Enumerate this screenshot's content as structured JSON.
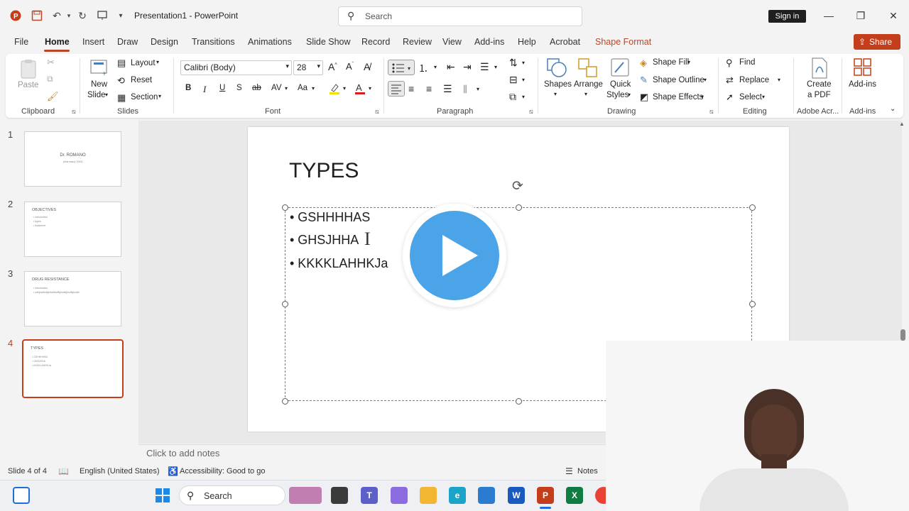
{
  "window": {
    "title": "Presentation1 - PowerPoint",
    "search_placeholder": "Search",
    "signin_label": "Sign in"
  },
  "tabs": [
    "File",
    "Home",
    "Insert",
    "Draw",
    "Design",
    "Transitions",
    "Animations",
    "Slide Show",
    "Record",
    "Review",
    "View",
    "Add-ins",
    "Help",
    "Acrobat",
    "Shape Format"
  ],
  "share_label": "Share",
  "ribbon": {
    "clipboard": {
      "paste": "Paste",
      "label": "Clipboard"
    },
    "slides": {
      "new_slide_line1": "New",
      "new_slide_line2": "Slide",
      "layout": "Layout",
      "reset": "Reset",
      "section": "Section",
      "label": "Slides"
    },
    "font": {
      "name": "Calibri (Body)",
      "size": "28",
      "label": "Font",
      "bold": "B",
      "italic": "I",
      "underline": "U",
      "strike": "S",
      "case": "Aa"
    },
    "paragraph": {
      "label": "Paragraph"
    },
    "drawing": {
      "shapes": "Shapes",
      "arrange": "Arrange",
      "quick_styles_line1": "Quick",
      "quick_styles_line2": "Styles",
      "shape_fill": "Shape Fill",
      "shape_outline": "Shape Outline",
      "shape_effects": "Shape Effects",
      "label": "Drawing"
    },
    "editing": {
      "find": "Find",
      "replace": "Replace",
      "select": "Select",
      "label": "Editing"
    },
    "adobe": {
      "create_line1": "Create",
      "create_line2": "a PDF",
      "label": "Adobe Acr..."
    },
    "addins": {
      "addins": "Add-ins",
      "label": "Add-ins"
    }
  },
  "thumbnails": [
    {
      "num": "1",
      "center_title": "Dr. ROMANO",
      "center_sub": "pharmacy 2024"
    },
    {
      "num": "2",
      "title": "OBJECTIVES",
      "lines": [
        "• introduction",
        "• types",
        "• treatment"
      ]
    },
    {
      "num": "3",
      "title": "DRUG RESISTANCE",
      "lines": [
        "• introduction",
        "• sdhjhsdfsdkjhfsdfksdfkjhsdkfjhsdfkjhsdkf"
      ]
    },
    {
      "num": "4",
      "title": "TYPES",
      "lines": [
        "• GSHHHHAS",
        "• GHSJHHA",
        "• KKKKLAHHKJa"
      ]
    }
  ],
  "slide": {
    "title": "TYPES",
    "bullets": [
      "• GSHHHHAS",
      "• GHSJHHA",
      "• KKKKLAHHKJa"
    ]
  },
  "notes_placeholder": "Click to add notes",
  "statusbar": {
    "slide_info": "Slide 4 of 4",
    "language": "English (United States)",
    "accessibility": "Accessibility: Good to go",
    "notes": "Notes"
  },
  "taskbar": {
    "search_placeholder": "Search"
  },
  "colors": {
    "accent": "#b7472a",
    "share": "#c43e1c",
    "play": "#4ba3e8"
  }
}
